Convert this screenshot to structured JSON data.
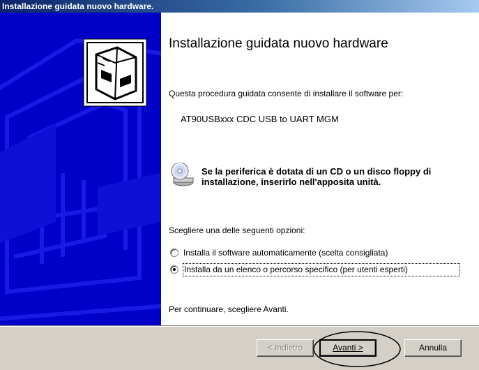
{
  "window": {
    "title": "Installazione guidata nuovo hardware."
  },
  "content": {
    "heading": "Installazione guidata nuovo hardware",
    "intro": "Questa procedura guidata consente di installare il software per:",
    "device_name": "AT90USBxxx CDC USB to UART MGM",
    "cd_notice": "Se la periferica è dotata di un CD o un disco floppy di installazione, inserirlo nell'apposita unità.",
    "choose_prompt": "Scegliere una delle seguenti opzioni:",
    "options": [
      {
        "label": "Installa il software automaticamente (scelta consigliata)",
        "selected": false
      },
      {
        "label": "Installa da un elenco o percorso specifico (per utenti esperti)",
        "selected": true
      }
    ],
    "continue_text": "Per continuare, scegliere Avanti."
  },
  "buttons": {
    "back": "< Indietro",
    "next": "Avanti >",
    "cancel": "Annulla"
  },
  "colors": {
    "title_bar": "#0a246a",
    "side_panel": "#0000c8",
    "dialog_face": "#d4d0c8"
  }
}
